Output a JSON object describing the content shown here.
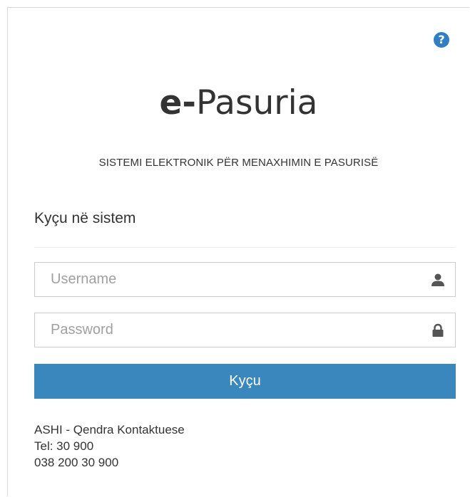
{
  "header": {
    "brand_prefix": "e-",
    "brand_name": "Pasuria",
    "subtitle": "SISTEMI ELEKTRONIK PËR MENAXHIMIN E PASURISË",
    "help_glyph": "?"
  },
  "login": {
    "heading": "Kyçu në sistem",
    "username_placeholder": "Username",
    "username_value": "",
    "password_placeholder": "Password",
    "password_value": "",
    "submit_label": "Kyçu"
  },
  "contact": {
    "org": "ASHI - Qendra Kontaktuese",
    "tel": "Tel: 30 900",
    "phone": "038 200 30 900"
  },
  "colors": {
    "accent": "#3a87bd",
    "help_icon": "#2f7fc1",
    "text": "#333333",
    "placeholder": "#a0a0a0",
    "border": "#cccccc"
  },
  "icons": {
    "help": "question-circle-icon",
    "username": "user-icon",
    "password": "lock-icon"
  }
}
